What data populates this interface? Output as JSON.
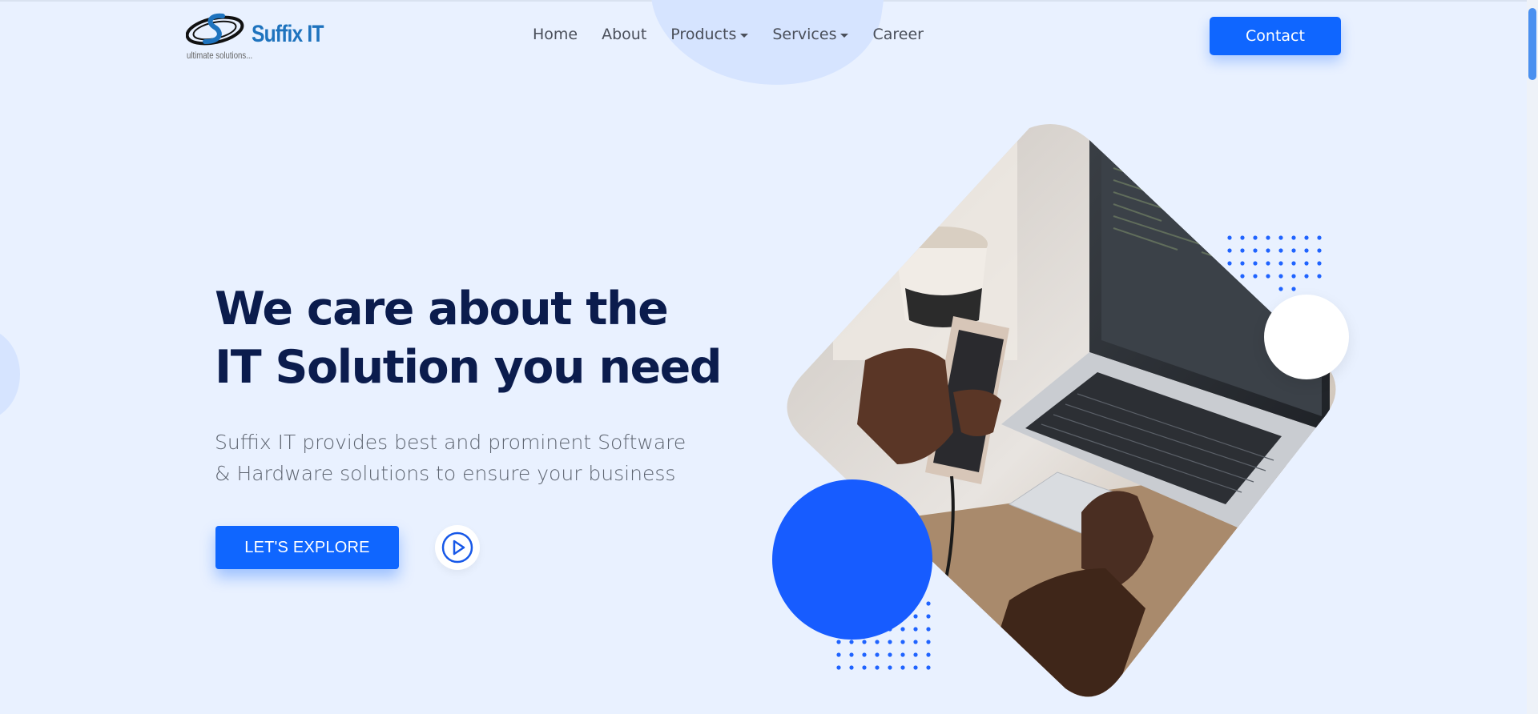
{
  "brand": {
    "name": "Suffix IT",
    "tagline": "ultimate solutions..."
  },
  "nav": {
    "items": [
      {
        "label": "Home",
        "has_dropdown": false
      },
      {
        "label": "About",
        "has_dropdown": false
      },
      {
        "label": "Products",
        "has_dropdown": true
      },
      {
        "label": "Services",
        "has_dropdown": true
      },
      {
        "label": "Career",
        "has_dropdown": false
      }
    ],
    "contact_label": "Contact"
  },
  "hero": {
    "title_line1": "We care about the",
    "title_line2": "IT Solution you need",
    "description": "Suffix IT provides best and prominent Software & Hardware solutions to ensure your business",
    "explore_label": "LET'S EXPLORE",
    "play_icon": "play-circle-icon"
  },
  "colors": {
    "page_background": "#e9f1ff",
    "primary": "#0f66ff",
    "heading": "#0b1c4d",
    "accent_circle": "#175cff"
  }
}
